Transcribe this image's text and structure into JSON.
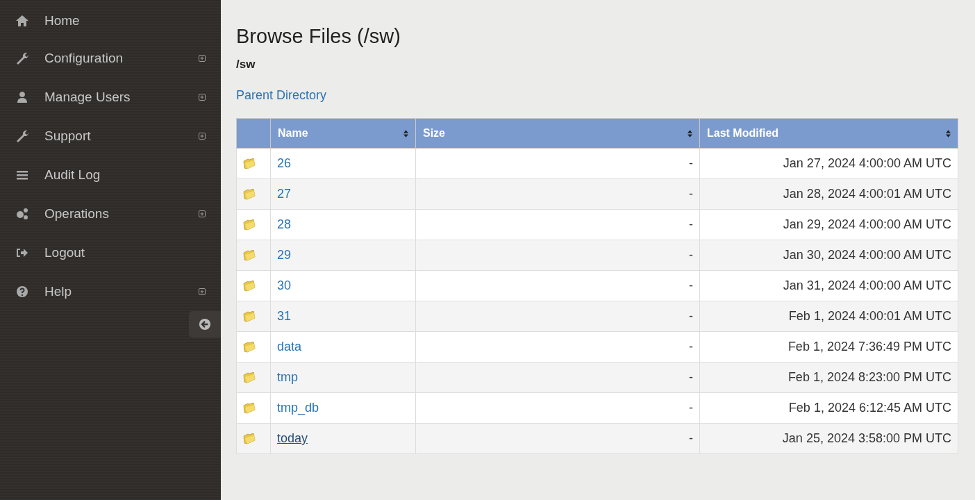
{
  "sidebar": {
    "items": [
      {
        "label": "Home",
        "expandable": false
      },
      {
        "label": "Configuration",
        "expandable": true
      },
      {
        "label": "Manage Users",
        "expandable": true
      },
      {
        "label": "Support",
        "expandable": true
      },
      {
        "label": "Audit Log",
        "expandable": false
      },
      {
        "label": "Operations",
        "expandable": true
      },
      {
        "label": "Logout",
        "expandable": false
      },
      {
        "label": "Help",
        "expandable": true
      }
    ]
  },
  "page": {
    "title": "Browse Files (/sw)",
    "path": "/sw",
    "parent_link": "Parent Directory"
  },
  "table": {
    "columns": [
      "Name",
      "Size",
      "Last Modified"
    ],
    "rows": [
      {
        "name": "26",
        "size": "-",
        "modified": "Jan 27, 2024 4:00:00 AM UTC",
        "hovered": false
      },
      {
        "name": "27",
        "size": "-",
        "modified": "Jan 28, 2024 4:00:01 AM UTC",
        "hovered": false
      },
      {
        "name": "28",
        "size": "-",
        "modified": "Jan 29, 2024 4:00:00 AM UTC",
        "hovered": false
      },
      {
        "name": "29",
        "size": "-",
        "modified": "Jan 30, 2024 4:00:00 AM UTC",
        "hovered": false
      },
      {
        "name": "30",
        "size": "-",
        "modified": "Jan 31, 2024 4:00:00 AM UTC",
        "hovered": false
      },
      {
        "name": "31",
        "size": "-",
        "modified": "Feb 1, 2024 4:00:01 AM UTC",
        "hovered": false
      },
      {
        "name": "data",
        "size": "-",
        "modified": "Feb 1, 2024 7:36:49 PM UTC",
        "hovered": false
      },
      {
        "name": "tmp",
        "size": "-",
        "modified": "Feb 1, 2024 8:23:00 PM UTC",
        "hovered": false
      },
      {
        "name": "tmp_db",
        "size": "-",
        "modified": "Feb 1, 2024 6:12:45 AM UTC",
        "hovered": false
      },
      {
        "name": "today",
        "size": "-",
        "modified": "Jan 25, 2024 3:58:00 PM UTC",
        "hovered": true
      }
    ]
  }
}
